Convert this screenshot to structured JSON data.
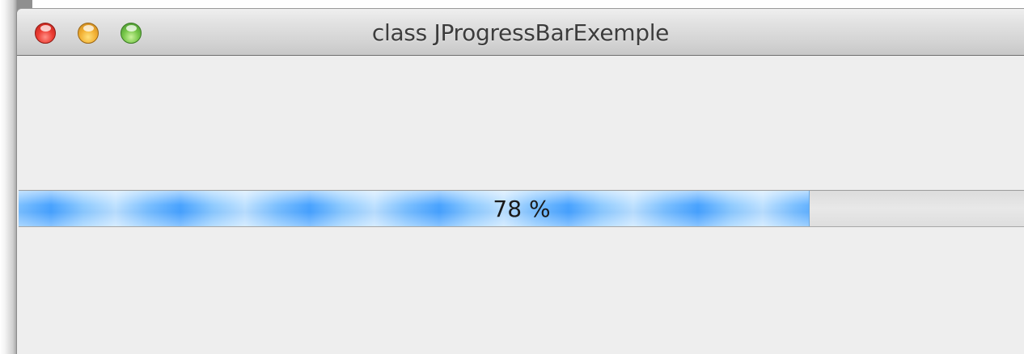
{
  "window": {
    "title": "class JProgressBarExemple"
  },
  "progress_bar": {
    "value": 0.786,
    "label": "78 %"
  },
  "colors": {
    "fill": "#49a3ff",
    "track": "#e0e0e0",
    "background": "#eeeeee"
  },
  "icons": {
    "close": "close-icon",
    "minimize": "minimize-icon",
    "zoom": "zoom-icon"
  }
}
